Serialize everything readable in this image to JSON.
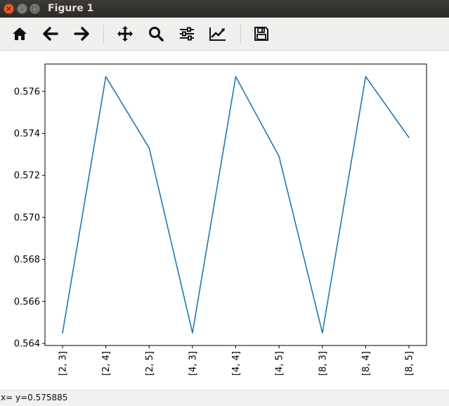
{
  "window": {
    "title": "Figure 1",
    "buttons": [
      "close-icon",
      "minimize-icon",
      "maximize-icon"
    ]
  },
  "toolbar": {
    "tools": [
      {
        "name": "home-icon"
      },
      {
        "name": "back-arrow-icon"
      },
      {
        "name": "forward-arrow-icon"
      },
      {
        "name": "pan-icon"
      },
      {
        "name": "zoom-icon"
      },
      {
        "name": "configure-subplots-icon"
      },
      {
        "name": "edit-axis-icon"
      },
      {
        "name": "save-icon"
      }
    ]
  },
  "status": {
    "text": "x= y=0.575885"
  },
  "chart_data": {
    "type": "line",
    "categories": [
      "[2, 3]",
      "[2, 4]",
      "[2, 5]",
      "[4, 3]",
      "[4, 4]",
      "[4, 5]",
      "[8, 3]",
      "[8, 4]",
      "[8, 5]"
    ],
    "series": [
      {
        "values": [
          0.5645,
          0.5767,
          0.5733,
          0.5645,
          0.5767,
          0.5729,
          0.5645,
          0.5767,
          0.5738
        ],
        "color": "#1f77b4"
      }
    ],
    "ylim": [
      0.5639,
      0.5773
    ],
    "yticks": [
      "0.564",
      "0.566",
      "0.568",
      "0.570",
      "0.572",
      "0.574",
      "0.576"
    ],
    "ytick_values": [
      0.564,
      0.566,
      0.568,
      0.57,
      0.572,
      0.574,
      0.576
    ],
    "grid": false,
    "title": "",
    "xlabel": "",
    "ylabel": ""
  }
}
